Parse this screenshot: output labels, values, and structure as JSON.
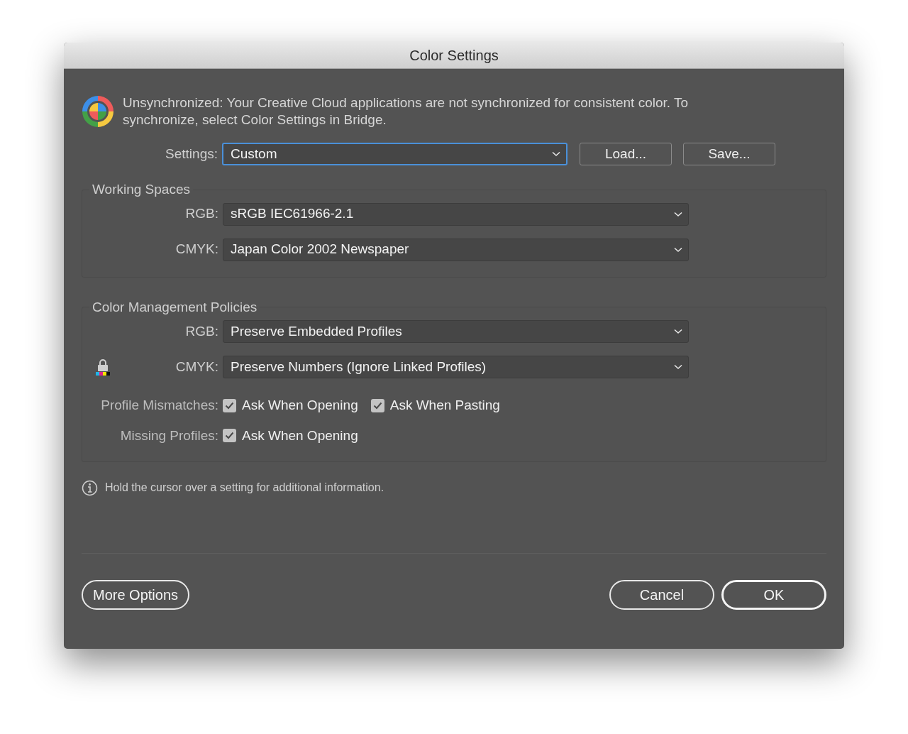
{
  "window": {
    "title": "Color Settings"
  },
  "notice": {
    "text": "Unsynchronized: Your Creative Cloud applications are not synchronized for consistent color. To synchronize, select Color Settings in Bridge."
  },
  "settings": {
    "label": "Settings:",
    "value": "Custom",
    "focused": true,
    "buttons": [
      "Load...",
      "Save..."
    ]
  },
  "working_spaces": {
    "title": "Working Spaces",
    "rows": [
      {
        "label": "RGB:",
        "value": "sRGB IEC61966-2.1",
        "locked": false
      },
      {
        "label": "CMYK:",
        "value": "Japan Color 2002 Newspaper",
        "locked": false
      }
    ]
  },
  "policies": {
    "title": "Color Management Policies",
    "rows": [
      {
        "label": "RGB:",
        "value": "Preserve Embedded Profiles",
        "locked": false
      },
      {
        "label": "CMYK:",
        "value": "Preserve Numbers (Ignore Linked Profiles)",
        "locked": true
      }
    ],
    "checks": [
      {
        "label": "Profile Mismatches:",
        "options": [
          {
            "label": "Ask When Opening",
            "checked": true
          },
          {
            "label": "Ask When Pasting",
            "checked": true
          }
        ]
      },
      {
        "label": "Missing Profiles:",
        "options": [
          {
            "label": "Ask When Opening",
            "checked": true
          }
        ]
      }
    ]
  },
  "info": {
    "text": "Hold the cursor over a setting for additional information."
  },
  "footer": {
    "buttons": [
      {
        "label": "More Options",
        "default": false
      },
      {
        "label": "Cancel",
        "default": false
      },
      {
        "label": "OK",
        "default": true
      }
    ]
  }
}
